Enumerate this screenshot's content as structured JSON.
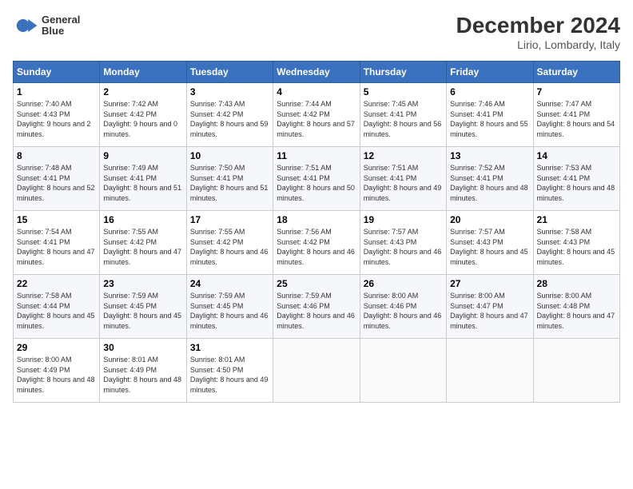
{
  "logo": {
    "line1": "General",
    "line2": "Blue"
  },
  "title": "December 2024",
  "location": "Lirio, Lombardy, Italy",
  "headers": [
    "Sunday",
    "Monday",
    "Tuesday",
    "Wednesday",
    "Thursday",
    "Friday",
    "Saturday"
  ],
  "weeks": [
    [
      {
        "day": "1",
        "sunrise": "7:40 AM",
        "sunset": "4:43 PM",
        "daylight": "9 hours and 2 minutes."
      },
      {
        "day": "2",
        "sunrise": "7:42 AM",
        "sunset": "4:42 PM",
        "daylight": "9 hours and 0 minutes."
      },
      {
        "day": "3",
        "sunrise": "7:43 AM",
        "sunset": "4:42 PM",
        "daylight": "8 hours and 59 minutes."
      },
      {
        "day": "4",
        "sunrise": "7:44 AM",
        "sunset": "4:42 PM",
        "daylight": "8 hours and 57 minutes."
      },
      {
        "day": "5",
        "sunrise": "7:45 AM",
        "sunset": "4:41 PM",
        "daylight": "8 hours and 56 minutes."
      },
      {
        "day": "6",
        "sunrise": "7:46 AM",
        "sunset": "4:41 PM",
        "daylight": "8 hours and 55 minutes."
      },
      {
        "day": "7",
        "sunrise": "7:47 AM",
        "sunset": "4:41 PM",
        "daylight": "8 hours and 54 minutes."
      }
    ],
    [
      {
        "day": "8",
        "sunrise": "7:48 AM",
        "sunset": "4:41 PM",
        "daylight": "8 hours and 52 minutes."
      },
      {
        "day": "9",
        "sunrise": "7:49 AM",
        "sunset": "4:41 PM",
        "daylight": "8 hours and 51 minutes."
      },
      {
        "day": "10",
        "sunrise": "7:50 AM",
        "sunset": "4:41 PM",
        "daylight": "8 hours and 51 minutes."
      },
      {
        "day": "11",
        "sunrise": "7:51 AM",
        "sunset": "4:41 PM",
        "daylight": "8 hours and 50 minutes."
      },
      {
        "day": "12",
        "sunrise": "7:51 AM",
        "sunset": "4:41 PM",
        "daylight": "8 hours and 49 minutes."
      },
      {
        "day": "13",
        "sunrise": "7:52 AM",
        "sunset": "4:41 PM",
        "daylight": "8 hours and 48 minutes."
      },
      {
        "day": "14",
        "sunrise": "7:53 AM",
        "sunset": "4:41 PM",
        "daylight": "8 hours and 48 minutes."
      }
    ],
    [
      {
        "day": "15",
        "sunrise": "7:54 AM",
        "sunset": "4:41 PM",
        "daylight": "8 hours and 47 minutes."
      },
      {
        "day": "16",
        "sunrise": "7:55 AM",
        "sunset": "4:42 PM",
        "daylight": "8 hours and 47 minutes."
      },
      {
        "day": "17",
        "sunrise": "7:55 AM",
        "sunset": "4:42 PM",
        "daylight": "8 hours and 46 minutes."
      },
      {
        "day": "18",
        "sunrise": "7:56 AM",
        "sunset": "4:42 PM",
        "daylight": "8 hours and 46 minutes."
      },
      {
        "day": "19",
        "sunrise": "7:57 AM",
        "sunset": "4:43 PM",
        "daylight": "8 hours and 46 minutes."
      },
      {
        "day": "20",
        "sunrise": "7:57 AM",
        "sunset": "4:43 PM",
        "daylight": "8 hours and 45 minutes."
      },
      {
        "day": "21",
        "sunrise": "7:58 AM",
        "sunset": "4:43 PM",
        "daylight": "8 hours and 45 minutes."
      }
    ],
    [
      {
        "day": "22",
        "sunrise": "7:58 AM",
        "sunset": "4:44 PM",
        "daylight": "8 hours and 45 minutes."
      },
      {
        "day": "23",
        "sunrise": "7:59 AM",
        "sunset": "4:45 PM",
        "daylight": "8 hours and 45 minutes."
      },
      {
        "day": "24",
        "sunrise": "7:59 AM",
        "sunset": "4:45 PM",
        "daylight": "8 hours and 46 minutes."
      },
      {
        "day": "25",
        "sunrise": "7:59 AM",
        "sunset": "4:46 PM",
        "daylight": "8 hours and 46 minutes."
      },
      {
        "day": "26",
        "sunrise": "8:00 AM",
        "sunset": "4:46 PM",
        "daylight": "8 hours and 46 minutes."
      },
      {
        "day": "27",
        "sunrise": "8:00 AM",
        "sunset": "4:47 PM",
        "daylight": "8 hours and 47 minutes."
      },
      {
        "day": "28",
        "sunrise": "8:00 AM",
        "sunset": "4:48 PM",
        "daylight": "8 hours and 47 minutes."
      }
    ],
    [
      {
        "day": "29",
        "sunrise": "8:00 AM",
        "sunset": "4:49 PM",
        "daylight": "8 hours and 48 minutes."
      },
      {
        "day": "30",
        "sunrise": "8:01 AM",
        "sunset": "4:49 PM",
        "daylight": "8 hours and 48 minutes."
      },
      {
        "day": "31",
        "sunrise": "8:01 AM",
        "sunset": "4:50 PM",
        "daylight": "8 hours and 49 minutes."
      },
      null,
      null,
      null,
      null
    ]
  ]
}
